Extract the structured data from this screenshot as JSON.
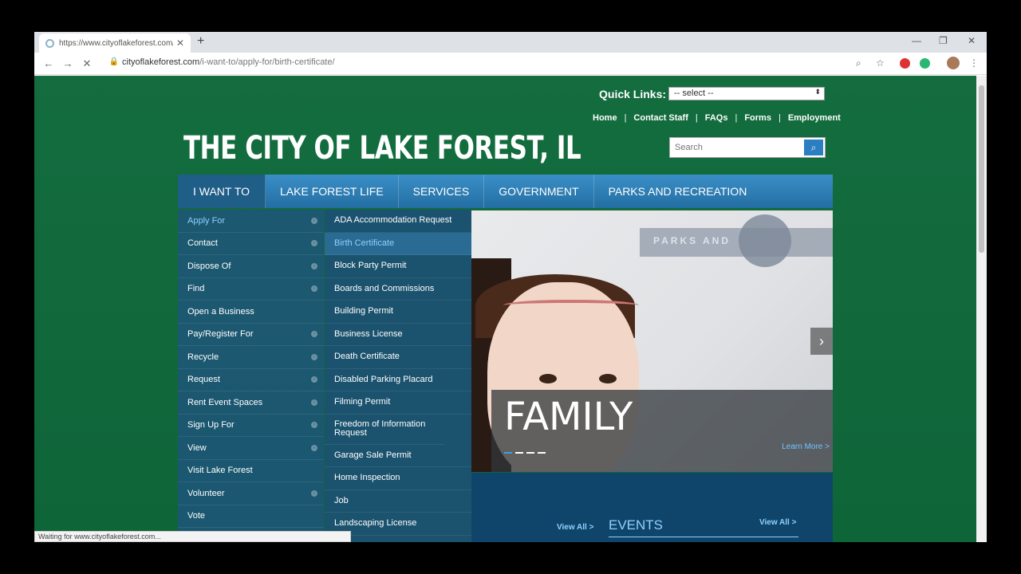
{
  "browser": {
    "tab_title": "https://www.cityoflakeforest.com/i-want-to/apply-for/birth-certificate/",
    "url_host": "cityoflakeforest.com",
    "url_path": "/i-want-to/apply-for/birth-certificate/",
    "status_text": "Waiting for www.cityoflakeforest.com..."
  },
  "header": {
    "quick_links_label": "Quick Links:",
    "quick_links_selected": "-- select --",
    "links": [
      "Home",
      "Contact Staff",
      "FAQs",
      "Forms",
      "Employment"
    ],
    "site_title": "THE CITY OF LAKE FOREST, IL",
    "search_placeholder": "Search"
  },
  "main_nav": [
    "I WANT TO",
    "LAKE FOREST LIFE",
    "SERVICES",
    "GOVERNMENT",
    "PARKS AND RECREATION"
  ],
  "menu_level1": [
    "Apply For",
    "Contact",
    "Dispose Of",
    "Find",
    "Open a Business",
    "Pay/Register For",
    "Recycle",
    "Request",
    "Rent Event Spaces",
    "Sign Up For",
    "View",
    "Visit Lake Forest",
    "Volunteer",
    "Vote"
  ],
  "menu_level2": [
    "ADA Accommodation Request",
    "Birth Certificate",
    "Block Party Permit",
    "Boards and Commissions",
    "Building Permit",
    "Business License",
    "Death Certificate",
    "Disabled Parking Placard",
    "Filming Permit",
    "Freedom of Information Request",
    "Garage Sale Permit",
    "Home Inspection",
    "Job",
    "Landscaping License"
  ],
  "hero": {
    "banner_text": "PARKS AND",
    "caption_title": "FAMILY",
    "learn_more": "Learn More >"
  },
  "lower": {
    "view_all_1": "View All >",
    "events_heading": "EVENTS",
    "view_all_2": "View All >"
  },
  "colors": {
    "page_green": "#0f6a3b",
    "nav_blue": "#236ea3",
    "link_blue": "#8fd0ff"
  }
}
